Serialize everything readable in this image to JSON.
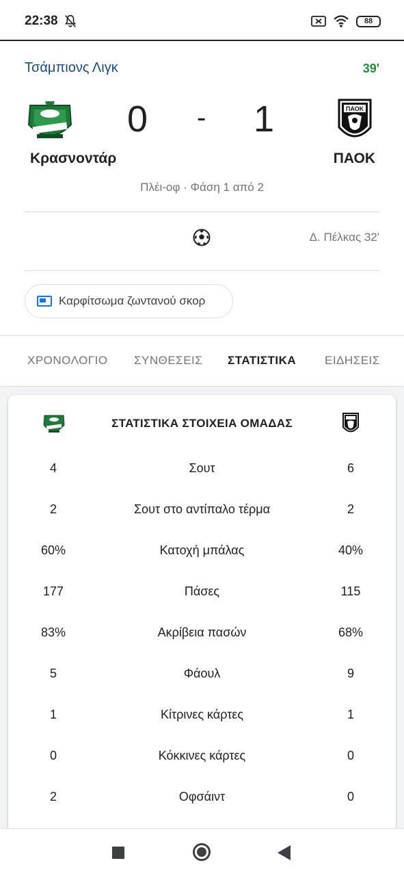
{
  "status_bar": {
    "time": "22:38",
    "battery": "88",
    "icons": [
      "bell-off-icon",
      "sim-error-icon",
      "wifi-icon",
      "battery-icon"
    ]
  },
  "match": {
    "league": "Τσάμπιονς Λιγκ",
    "minute": "39'",
    "home_team": "Κρασνοντάρ",
    "away_team": "ΠΑΟΚ",
    "home_score": "0",
    "dash": "-",
    "away_score": "1",
    "stage": "Πλέι-οφ · Φάση 1 από 2",
    "goal_scorer": "Δ. Πέλκας 32'"
  },
  "pin_button": {
    "label": "Καρφίτσωμα ζωντανού σκορ"
  },
  "tabs": [
    {
      "label": "ΧΡΟΝΟΛΟΓΙΟ",
      "active": false
    },
    {
      "label": "ΣΥΝΘΕΣΕΙΣ",
      "active": false
    },
    {
      "label": "ΣΤΑΤΙΣΤΙΚΑ",
      "active": true
    },
    {
      "label": "ΕΙΔΗΣΕΙΣ",
      "active": false
    }
  ],
  "stats": {
    "title": "ΣΤΑΤΙΣΤΙΚΑ ΣΤΟΙΧΕΙΑ ΟΜΑΔΑΣ",
    "rows": [
      {
        "home": "4",
        "label": "Σουτ",
        "away": "6"
      },
      {
        "home": "2",
        "label": "Σουτ στο αντίπαλο τέρμα",
        "away": "2"
      },
      {
        "home": "60%",
        "label": "Κατοχή μπάλας",
        "away": "40%"
      },
      {
        "home": "177",
        "label": "Πάσες",
        "away": "115"
      },
      {
        "home": "83%",
        "label": "Ακρίβεια πασών",
        "away": "68%"
      },
      {
        "home": "5",
        "label": "Φάουλ",
        "away": "9"
      },
      {
        "home": "1",
        "label": "Κίτρινες κάρτες",
        "away": "1"
      },
      {
        "home": "0",
        "label": "Κόκκινες κάρτες",
        "away": "0"
      },
      {
        "home": "2",
        "label": "Οφσάιντ",
        "away": "0"
      }
    ]
  },
  "colors": {
    "league_blue": "#1a4a7a",
    "live_green": "#1e8e3e",
    "accent_blue": "#1a73e8",
    "krasnodar_green": "#1f7a3a",
    "paok_black": "#111111"
  }
}
